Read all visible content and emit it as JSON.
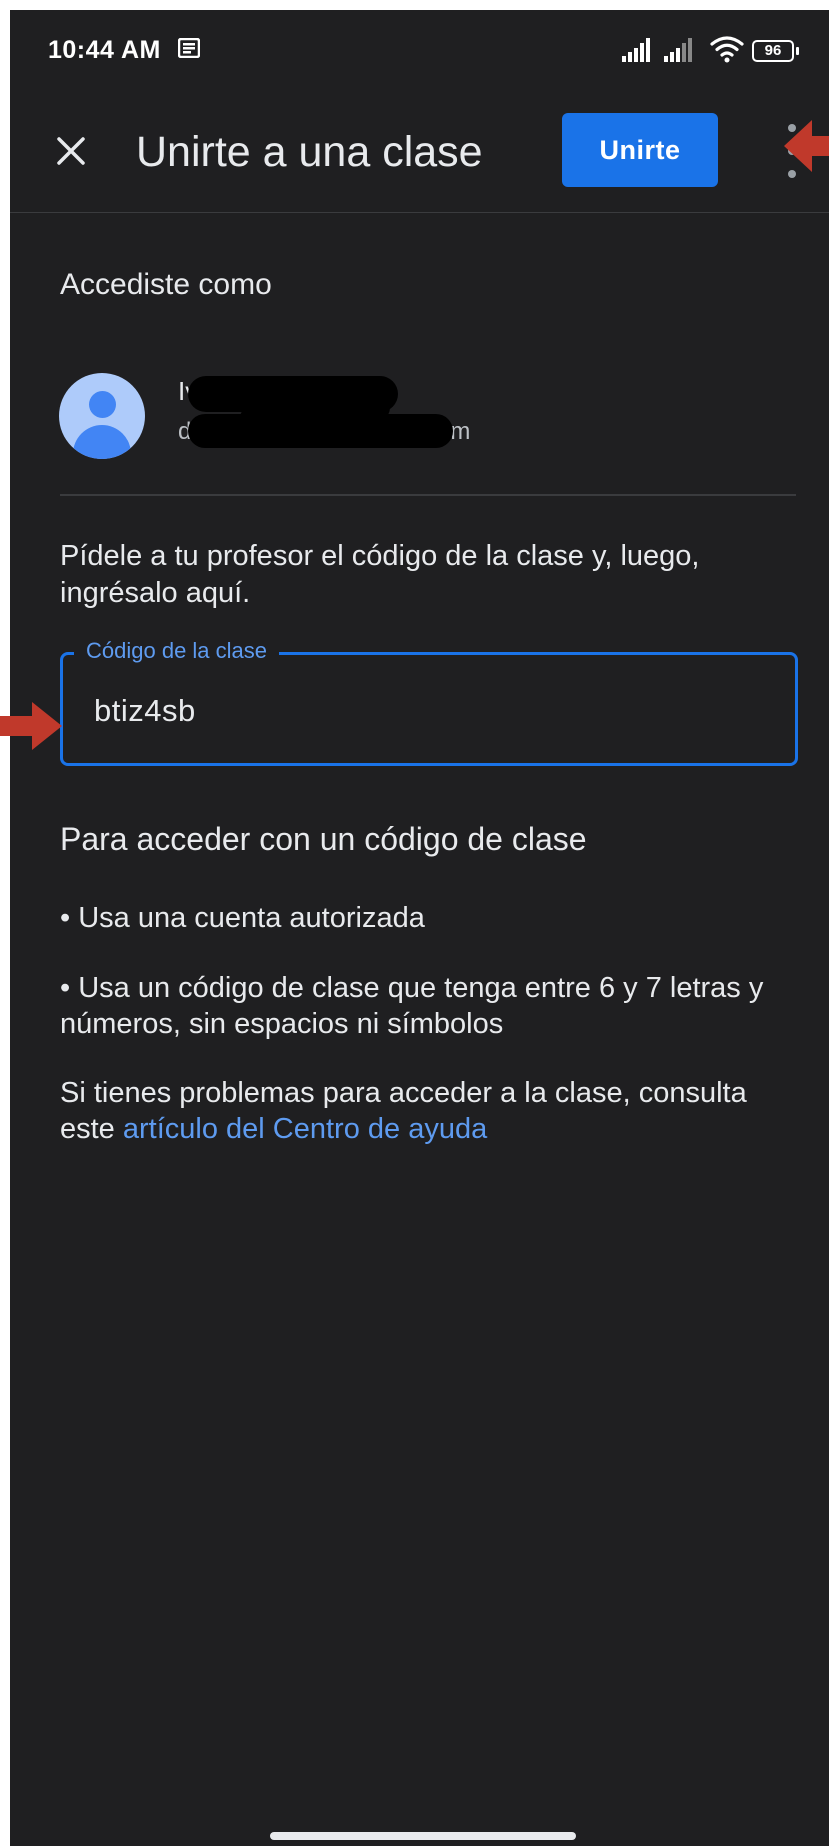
{
  "status_bar": {
    "time": "10:44 AM",
    "battery": "96",
    "notification_icon": "news-icon",
    "signal_icon": "signal-icon",
    "wifi_icon": "wifi-icon"
  },
  "app_bar": {
    "close_icon": "close-icon",
    "title": "Unirte a una clase",
    "join_button": "Unirte",
    "more_icon": "more-vert-icon",
    "accent_color": "#1a73e8"
  },
  "account": {
    "heading": "Accediste como",
    "name": "Iv",
    "email": "d",
    "email_tail": "...com",
    "avatar_icon": "person-avatar-icon"
  },
  "instruction": "Pídele a tu profesor el código de la clase y, luego, ingrésalo aquí.",
  "class_code_field": {
    "label": "Código de la clase",
    "value": "btiz4sb"
  },
  "help": {
    "heading": "Para acceder con un código de clase",
    "bullet1": "• Usa una cuenta autorizada",
    "bullet2": "• Usa un código de clase que tenga entre 6 y 7 letras y números, sin espacios ni símbolos",
    "trouble_text": "Si tienes problemas para acceder a la clase, consulta este ",
    "trouble_link": "artículo del Centro de ayuda",
    "link_color": "#5e9bf0"
  },
  "annotations": {
    "arrow_color": "#c0392b"
  }
}
